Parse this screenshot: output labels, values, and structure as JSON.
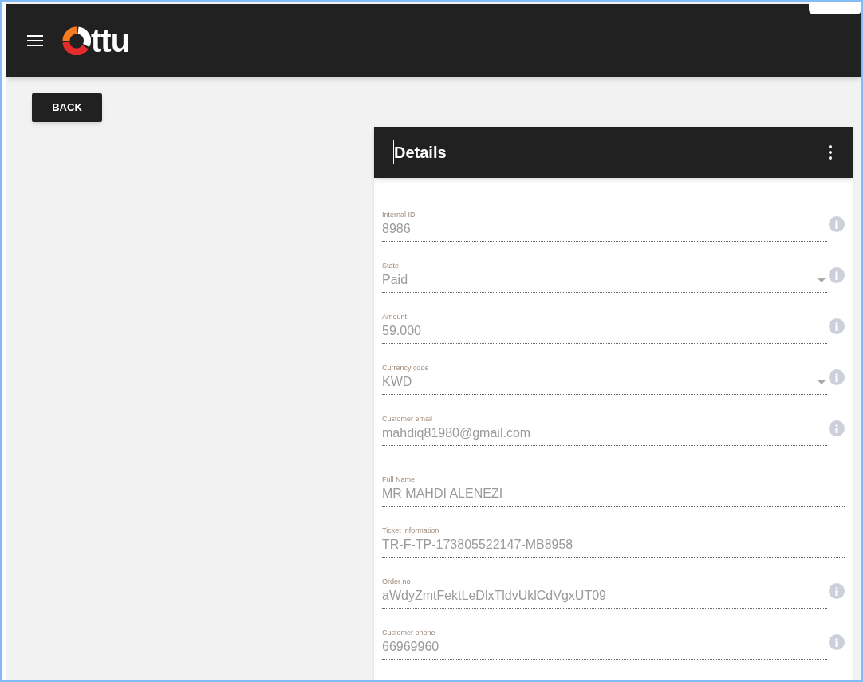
{
  "header": {
    "logo_text": "ttu"
  },
  "back_button": "BACK",
  "card": {
    "title": "Details",
    "fields": [
      {
        "label": "Internal ID",
        "value": "8986",
        "kind": "text",
        "info": true
      },
      {
        "label": "State",
        "value": "Paid",
        "kind": "select",
        "info": true
      },
      {
        "label": "Amount",
        "value": "59.000",
        "kind": "text",
        "info": true
      },
      {
        "label": "Currency code",
        "value": "KWD",
        "kind": "select",
        "info": true
      },
      {
        "label": "Customer email",
        "value": "mahdiq81980@gmail.com",
        "kind": "text",
        "info": true
      },
      {
        "label": "Full Name",
        "value": "MR MAHDI ALENEZI",
        "kind": "text",
        "info": false
      },
      {
        "label": "Ticket Information",
        "value": "TR-F-TP-173805522147-MB8958",
        "kind": "text",
        "info": false
      },
      {
        "label": "Order no",
        "value": "aWdyZmtFektLeDlxTldvUklCdVgxUT09",
        "kind": "text",
        "info": true
      },
      {
        "label": "Customer phone",
        "value": "66969960",
        "kind": "text",
        "info": true
      }
    ]
  }
}
